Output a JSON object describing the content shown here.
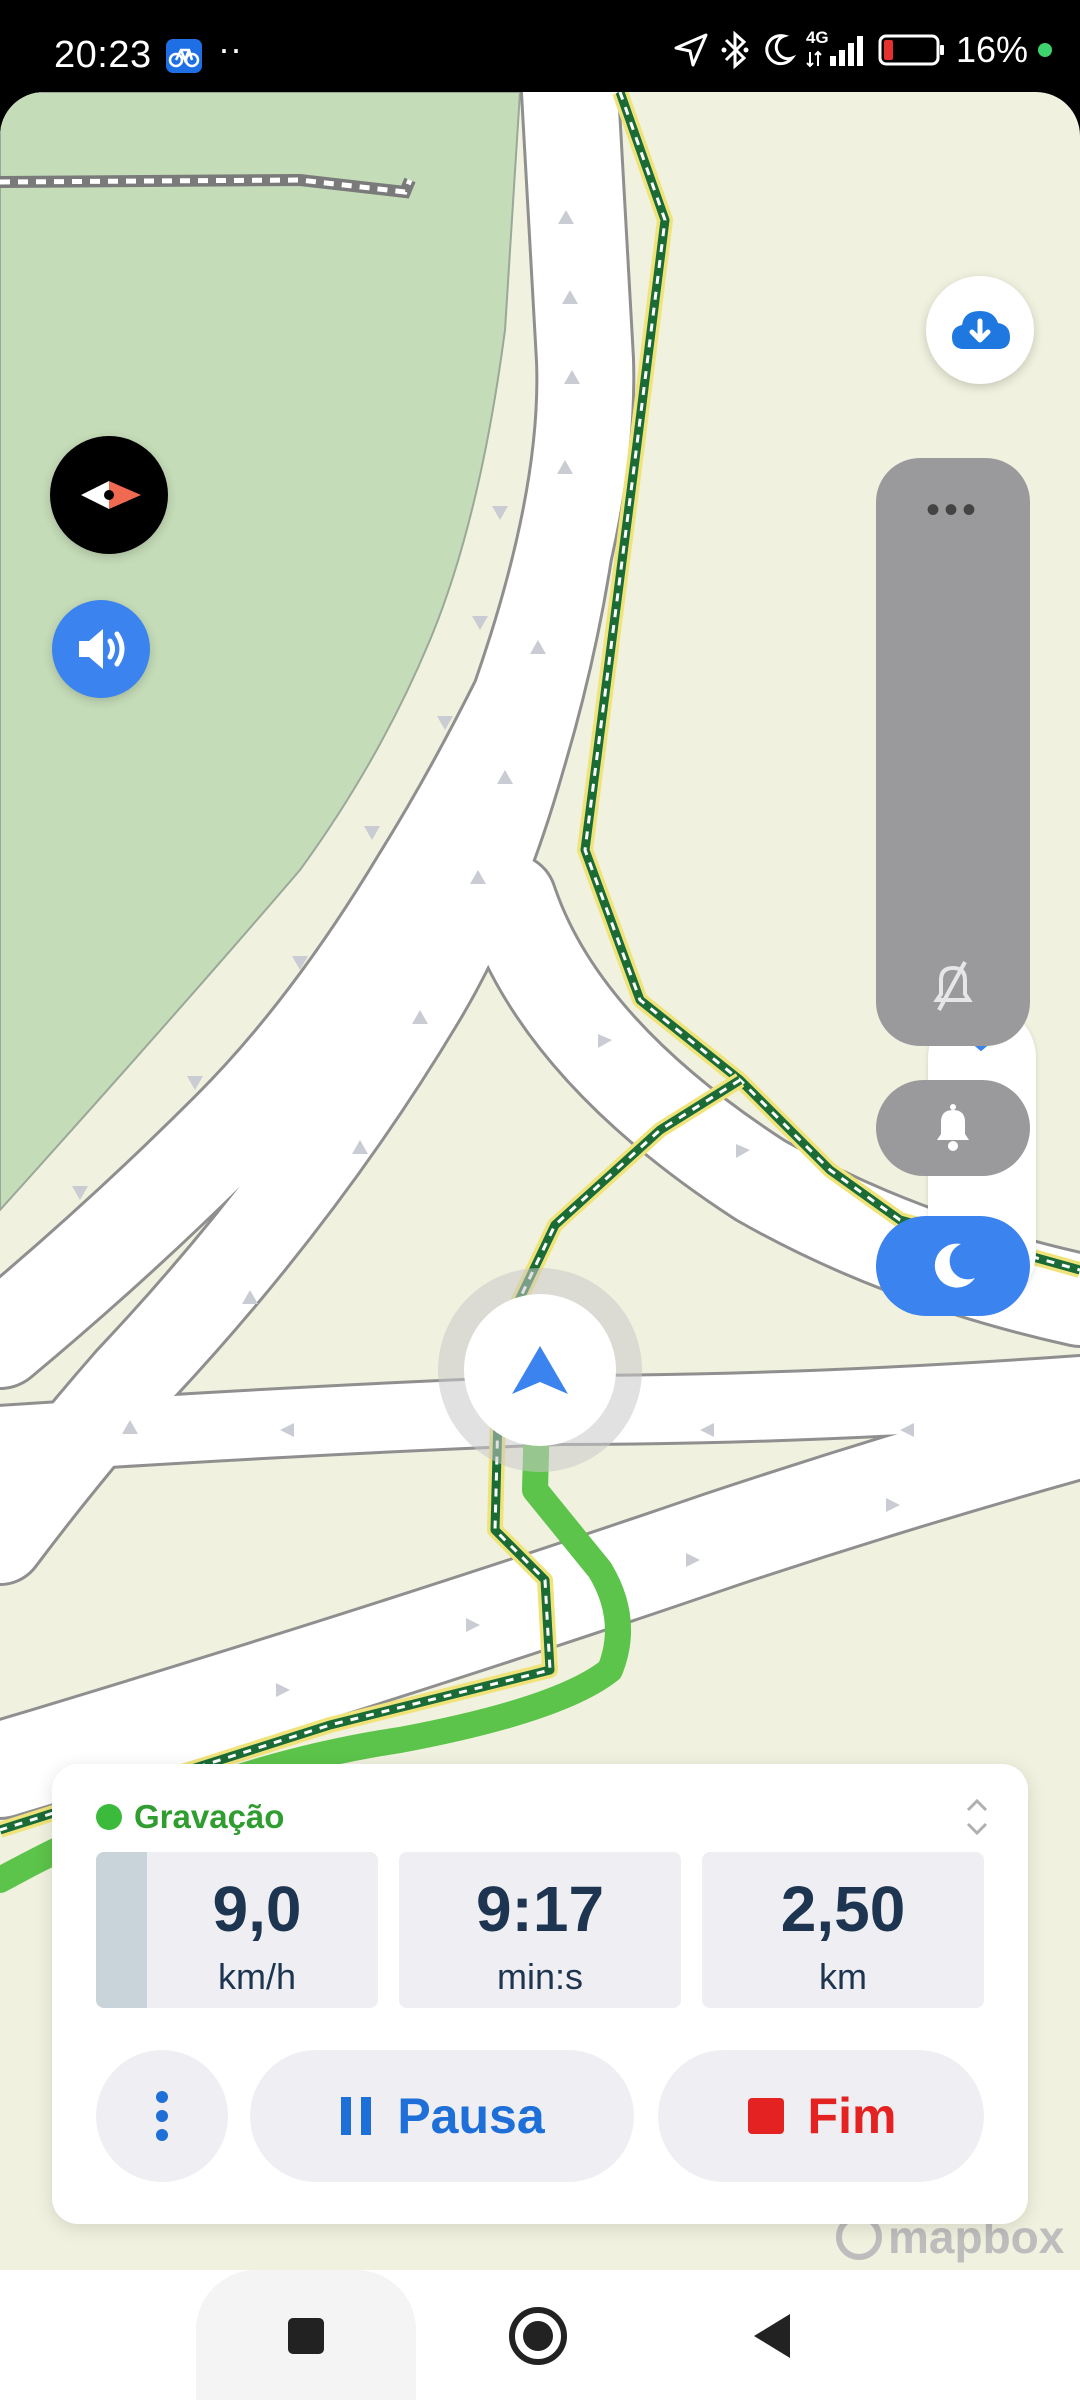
{
  "status_bar": {
    "time": "20:23",
    "app_icon": "bicycle-icon",
    "overflow": "··",
    "network": "4G",
    "battery": "16%",
    "icons": [
      "location-arrow-icon",
      "bluetooth-icon",
      "moon-icon",
      "signal-icon",
      "battery-icon"
    ]
  },
  "map": {
    "attribution": "mapbox",
    "colors": {
      "land": "#f1f1df",
      "park": "#c5dcb8",
      "road": "#ffffff",
      "recorded_track": "#5cc44a",
      "trail": "#1a6b35",
      "accent_blue": "#3b83ee"
    }
  },
  "controls": {
    "compass": "compass-icon",
    "sound": "speaker-icon",
    "download": "cloud-download-icon",
    "panel_more": "•••",
    "bell": "bell-icon",
    "night_mode": "moon-icon"
  },
  "tracking_card": {
    "status_label": "Gravação",
    "stats": [
      {
        "value": "9,0",
        "unit": "km/h"
      },
      {
        "value": "9:17",
        "unit": "min:s"
      },
      {
        "value": "2,50",
        "unit": "km"
      }
    ],
    "speed_fill_fraction": 0.18,
    "buttons": {
      "more": "more-vertical-icon",
      "pause": "Pausa",
      "end": "Fim"
    }
  }
}
